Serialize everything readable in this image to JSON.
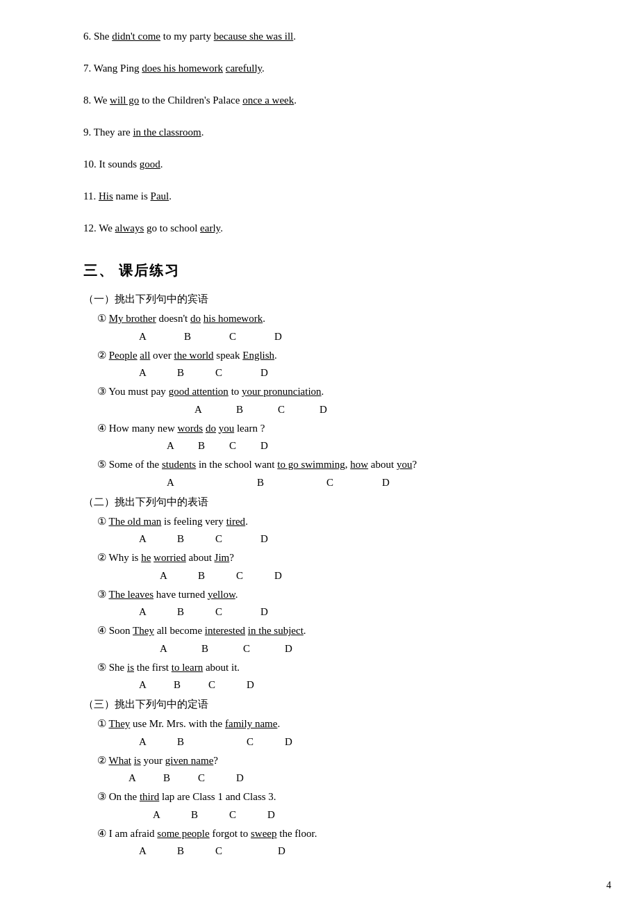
{
  "page_number": "4",
  "numbered_sentences": [
    {
      "num": "6.",
      "parts": [
        {
          "text": "She ",
          "underline": false
        },
        {
          "text": "didn't come",
          "underline": true
        },
        {
          "text": " to my party ",
          "underline": false
        },
        {
          "text": "because she was ill",
          "underline": true
        },
        {
          "text": ".",
          "underline": false
        }
      ]
    },
    {
      "num": "7.",
      "parts": [
        {
          "text": "Wang Ping ",
          "underline": false
        },
        {
          "text": "does his homework",
          "underline": true
        },
        {
          "text": " ",
          "underline": false
        },
        {
          "text": "carefully",
          "underline": true
        },
        {
          "text": ".",
          "underline": false
        }
      ]
    },
    {
      "num": "8.",
      "parts": [
        {
          "text": "We ",
          "underline": false
        },
        {
          "text": "will go",
          "underline": true
        },
        {
          "text": " to the Children's Palace ",
          "underline": false
        },
        {
          "text": "once a week",
          "underline": true
        },
        {
          "text": ".",
          "underline": false
        }
      ]
    },
    {
      "num": "9.",
      "parts": [
        {
          "text": "They are ",
          "underline": false
        },
        {
          "text": "in the classroom",
          "underline": true
        },
        {
          "text": ".",
          "underline": false
        }
      ]
    },
    {
      "num": "10.",
      "parts": [
        {
          "text": "It sounds ",
          "underline": false
        },
        {
          "text": "good",
          "underline": true
        },
        {
          "text": ".",
          "underline": false
        }
      ]
    },
    {
      "num": "11.",
      "parts": [
        {
          "text": "",
          "underline": false
        },
        {
          "text": "His",
          "underline": true
        },
        {
          "text": " name is ",
          "underline": false
        },
        {
          "text": "Paul",
          "underline": true
        },
        {
          "text": ".",
          "underline": false
        }
      ]
    },
    {
      "num": "12.",
      "parts": [
        {
          "text": "We ",
          "underline": false
        },
        {
          "text": "always",
          "underline": true
        },
        {
          "text": " go to school ",
          "underline": false
        },
        {
          "text": "early",
          "underline": true
        },
        {
          "text": ".",
          "underline": false
        }
      ]
    }
  ],
  "section3": {
    "title": "三、  课后练习",
    "subsections": [
      {
        "label": "（一）挑出下列句中的宾语",
        "items": [
          {
            "num": "①",
            "sentence_parts": [
              {
                "text": "My brother",
                "underline": true
              },
              {
                "text": " doesn't ",
                "underline": false
              },
              {
                "text": "do",
                "underline": true
              },
              {
                "text": " ",
                "underline": false
              },
              {
                "text": "his homework",
                "underline": true
              },
              {
                "text": ".",
                "underline": false
              }
            ],
            "abcd_indent": 1,
            "abcd": [
              "A",
              "B",
              "C",
              "D"
            ]
          },
          {
            "num": "②",
            "sentence_parts": [
              {
                "text": "People",
                "underline": true
              },
              {
                "text": " ",
                "underline": false
              },
              {
                "text": "all",
                "underline": true
              },
              {
                "text": " over ",
                "underline": false
              },
              {
                "text": "the world",
                "underline": true
              },
              {
                "text": " speak ",
                "underline": false
              },
              {
                "text": "English",
                "underline": true
              },
              {
                "text": ".",
                "underline": false
              }
            ],
            "abcd_indent": 1,
            "abcd": [
              "A",
              "B",
              "C",
              "D"
            ]
          },
          {
            "num": "③",
            "sentence_parts": [
              {
                "text": " You must pay ",
                "underline": false
              },
              {
                "text": "good attention",
                "underline": true
              },
              {
                "text": " to ",
                "underline": false
              },
              {
                "text": "your pronunciation",
                "underline": true
              },
              {
                "text": ".",
                "underline": false
              }
            ],
            "abcd_indent": 3,
            "abcd": [
              "A",
              "B",
              "C",
              "D"
            ]
          },
          {
            "num": "④",
            "sentence_parts": [
              {
                "text": " How many new ",
                "underline": false
              },
              {
                "text": "words",
                "underline": true
              },
              {
                "text": " ",
                "underline": false
              },
              {
                "text": "do",
                "underline": true
              },
              {
                "text": " ",
                "underline": false
              },
              {
                "text": "you",
                "underline": true
              },
              {
                "text": " learn ?",
                "underline": false
              }
            ],
            "abcd_indent": 2,
            "abcd": [
              "A",
              "B",
              "C",
              "D"
            ]
          },
          {
            "num": "⑤",
            "sentence_parts": [
              {
                "text": " Some of the ",
                "underline": false
              },
              {
                "text": "students",
                "underline": true
              },
              {
                "text": " in the school want ",
                "underline": false
              },
              {
                "text": "to go swimming",
                "underline": true
              },
              {
                "text": ", ",
                "underline": false
              },
              {
                "text": "how",
                "underline": true
              },
              {
                "text": " about ",
                "underline": false
              },
              {
                "text": "you",
                "underline": true
              },
              {
                "text": "?",
                "underline": false
              }
            ],
            "abcd_indent": 4,
            "abcd": [
              "A",
              "B",
              "C",
              "D"
            ]
          }
        ]
      },
      {
        "label": "（二）挑出下列句中的表语",
        "items": [
          {
            "num": "①",
            "sentence_parts": [
              {
                "text": "The old man",
                "underline": true
              },
              {
                "text": " is feeling very ",
                "underline": false
              },
              {
                "text": "tired",
                "underline": true
              },
              {
                "text": ".",
                "underline": false
              }
            ],
            "abcd_indent": 1,
            "abcd": [
              "A",
              "B",
              "C",
              "D"
            ]
          },
          {
            "num": "②",
            "sentence_parts": [
              {
                "text": " Why is ",
                "underline": false
              },
              {
                "text": "he",
                "underline": true
              },
              {
                "text": " ",
                "underline": false
              },
              {
                "text": "worried",
                "underline": true
              },
              {
                "text": " about ",
                "underline": false
              },
              {
                "text": "Jim",
                "underline": true
              },
              {
                "text": "?",
                "underline": false
              }
            ],
            "abcd_indent": 2,
            "abcd": [
              "A",
              "B",
              "C",
              "D"
            ]
          },
          {
            "num": "③",
            "sentence_parts": [
              {
                "text": "The leaves",
                "underline": true
              },
              {
                "text": " have turned ",
                "underline": false
              },
              {
                "text": "yellow",
                "underline": true
              },
              {
                "text": ".",
                "underline": false
              }
            ],
            "abcd_indent": 1,
            "abcd": [
              "A",
              "B",
              "C",
              "D"
            ]
          },
          {
            "num": "④",
            "sentence_parts": [
              {
                "text": " Soon ",
                "underline": false
              },
              {
                "text": "They",
                "underline": true
              },
              {
                "text": " all become ",
                "underline": false
              },
              {
                "text": "interested",
                "underline": true
              },
              {
                "text": " ",
                "underline": false
              },
              {
                "text": "in the subject",
                "underline": true
              },
              {
                "text": ".",
                "underline": false
              }
            ],
            "abcd_indent": 2,
            "abcd": [
              "A",
              "B",
              "C",
              "D"
            ]
          },
          {
            "num": "⑤",
            "sentence_parts": [
              {
                "text": " She ",
                "underline": false
              },
              {
                "text": "is",
                "underline": true
              },
              {
                "text": " the first ",
                "underline": false
              },
              {
                "text": "to learn",
                "underline": true
              },
              {
                "text": " about it.",
                "underline": false
              }
            ],
            "abcd_indent": 1,
            "abcd": [
              "A",
              "B",
              "C",
              "D"
            ]
          }
        ]
      },
      {
        "label": "（三）挑出下列句中的定语",
        "items": [
          {
            "num": "①",
            "sentence_parts": [
              {
                "text": "They",
                "underline": true
              },
              {
                "text": " use Mr. Mrs. with the ",
                "underline": false
              },
              {
                "text": "family name",
                "underline": true
              },
              {
                "text": ".",
                "underline": false
              }
            ],
            "abcd_indent": 1,
            "abcd": [
              "A",
              "B",
              "C",
              "D"
            ]
          },
          {
            "num": "②",
            "sentence_parts": [
              {
                "text": "What",
                "underline": true
              },
              {
                "text": " ",
                "underline": false
              },
              {
                "text": "is",
                "underline": true
              },
              {
                "text": " your ",
                "underline": false
              },
              {
                "text": "given name",
                "underline": true
              },
              {
                "text": "?",
                "underline": false
              }
            ],
            "abcd_indent": 1,
            "abcd": [
              "A",
              "B",
              "C",
              "D"
            ]
          },
          {
            "num": "③",
            "sentence_parts": [
              {
                "text": " On the ",
                "underline": false
              },
              {
                "text": "third",
                "underline": true
              },
              {
                "text": " lap are Class 1 and Class 3.",
                "underline": false
              }
            ],
            "abcd_indent": 2,
            "abcd": [
              "A",
              "B",
              "C",
              "D"
            ]
          },
          {
            "num": "④",
            "sentence_parts": [
              {
                "text": " I am afraid ",
                "underline": false
              },
              {
                "text": "some people",
                "underline": true
              },
              {
                "text": " forgot to ",
                "underline": false
              },
              {
                "text": "sweep",
                "underline": true
              },
              {
                "text": " the floor.",
                "underline": false
              }
            ],
            "abcd_indent": 1,
            "abcd": [
              "A",
              "B",
              "C",
              "D"
            ]
          }
        ]
      }
    ]
  }
}
